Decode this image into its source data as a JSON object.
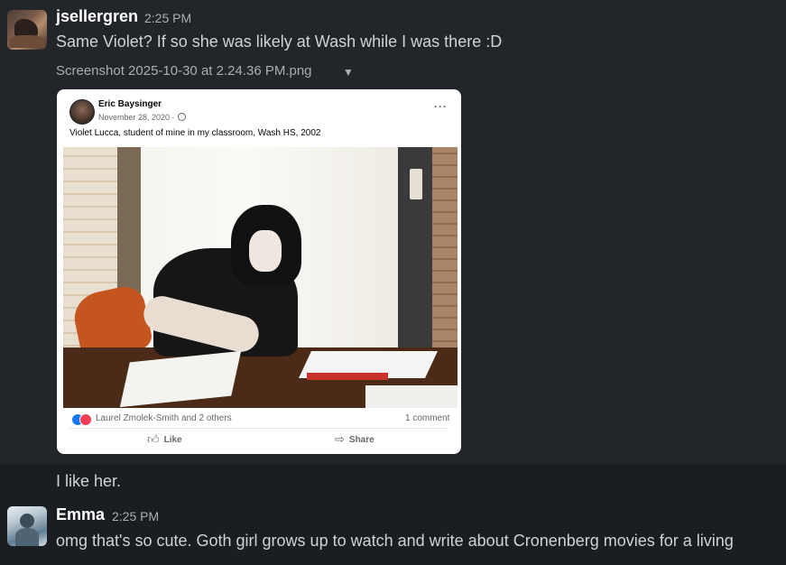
{
  "messages": [
    {
      "user": "jsellergren",
      "time": "2:25 PM",
      "text": "Same Violet? If so she was likely at Wash while I was there :D",
      "attachment": {
        "filename": "Screenshot 2025-10-30 at 2.24.36 PM.png",
        "post": {
          "author": "Eric Baysinger",
          "date": "November 28, 2020 · ",
          "caption": "Violet Lucca, student of mine in my classroom, Wash HS, 2002",
          "reactions_text": "Laurel Zmolek-Smith and 2 others",
          "comments_text": "1 comment",
          "like_label": "Like",
          "share_label": "Share"
        }
      },
      "followup_text": "I like her."
    },
    {
      "user": "Emma",
      "time": "2:25 PM",
      "text": "omg that's so cute. Goth girl grows up to watch and write about Cronenberg movies for a living"
    }
  ],
  "colors": {
    "background": "#1a1d21",
    "hover_background": "#222529",
    "text": "#d1d2d3",
    "muted": "#abaeb3",
    "fb_blue": "#1877f2",
    "fb_love": "#f33e58"
  },
  "icons": {
    "caret": "caret-down-icon",
    "globe": "globe-icon",
    "more": "more-options-icon",
    "like": "thumbs-up-icon",
    "share": "share-arrow-icon"
  }
}
